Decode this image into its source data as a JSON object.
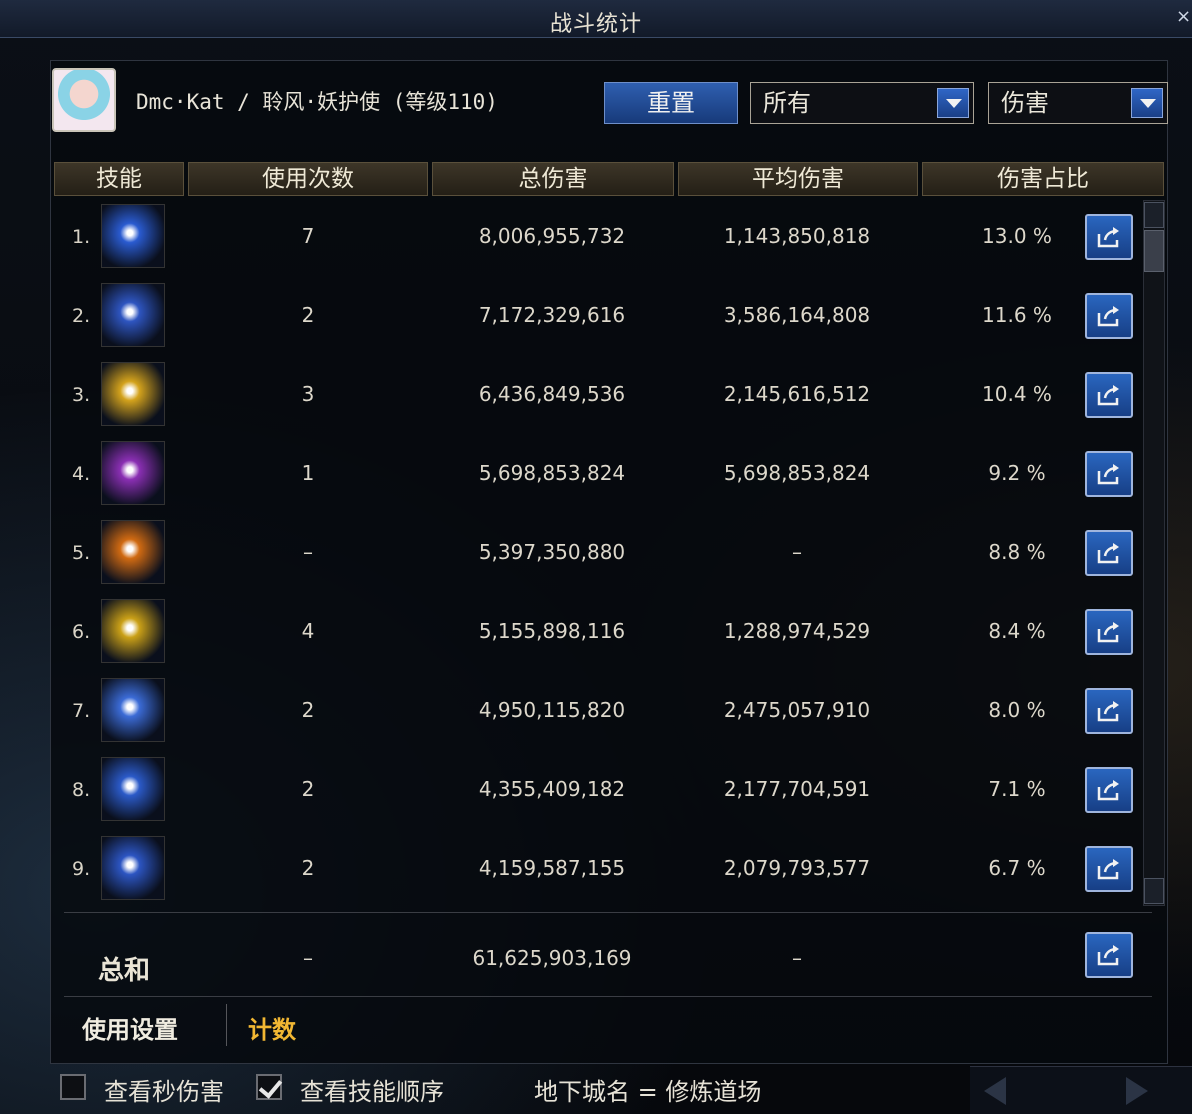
{
  "window": {
    "title": "战斗统计",
    "close": "×"
  },
  "character": {
    "text": "Dmc·Kat / 聆风·妖护使 (等级110)"
  },
  "controls": {
    "reset_label": "重置",
    "filter_select": "所有",
    "metric_select": "伤害"
  },
  "columns": [
    "技能",
    "使用次数",
    "总伤害",
    "平均伤害",
    "伤害占比"
  ],
  "rows": [
    {
      "rank": "1.",
      "count": "7",
      "total": "8,006,955,732",
      "avg": "1,143,850,818",
      "pct": "13.0 %",
      "icon": "skill-icon-blue-burst",
      "color": "#2a5bd0"
    },
    {
      "rank": "2.",
      "count": "2",
      "total": "7,172,329,616",
      "avg": "3,586,164,808",
      "pct": "11.6 %",
      "icon": "skill-icon-blue-spikes",
      "color": "#2e55c0"
    },
    {
      "rank": "3.",
      "count": "3",
      "total": "6,436,849,536",
      "avg": "2,145,616,512",
      "pct": "10.4 %",
      "icon": "skill-icon-gold-slash",
      "color": "#d3a21c"
    },
    {
      "rank": "4.",
      "count": "1",
      "total": "5,698,853,824",
      "avg": "5,698,853,824",
      "pct": "9.2 %",
      "icon": "skill-icon-purple-figure",
      "color": "#8a2fb3"
    },
    {
      "rank": "5.",
      "count": "–",
      "total": "5,397,350,880",
      "avg": "–",
      "pct": "8.8 %",
      "icon": "skill-icon-fire-beast",
      "color": "#d06a12"
    },
    {
      "rank": "6.",
      "count": "4",
      "total": "5,155,898,116",
      "avg": "1,288,974,529",
      "pct": "8.4 %",
      "icon": "skill-icon-gold-claw",
      "color": "#caa017"
    },
    {
      "rank": "7.",
      "count": "2",
      "total": "4,950,115,820",
      "avg": "2,475,057,910",
      "pct": "8.0 %",
      "icon": "skill-icon-blue-bird",
      "color": "#3b6bd6"
    },
    {
      "rank": "8.",
      "count": "2",
      "total": "4,355,409,182",
      "avg": "2,177,704,591",
      "pct": "7.1 %",
      "icon": "skill-icon-blue-vortex",
      "color": "#2b5ac8"
    },
    {
      "rank": "9.",
      "count": "2",
      "total": "4,159,587,155",
      "avg": "2,079,793,577",
      "pct": "6.7 %",
      "icon": "skill-icon-blue-wave",
      "color": "#2c55c2"
    }
  ],
  "total": {
    "label": "总和",
    "count": "–",
    "total": "61,625,903,169",
    "avg": "–"
  },
  "tabs": {
    "settings": "使用设置",
    "count": "计数"
  },
  "bottom": {
    "dps_label": "查看秒伤害",
    "dps_checked": false,
    "order_label": "查看技能顺序",
    "order_checked": true,
    "dungeon_label": "地下城名 = 修炼道场"
  },
  "colors": {
    "accent_blue": "#1f4ea0",
    "tab_active": "#f1b733",
    "header_gold": "#3d3628"
  }
}
